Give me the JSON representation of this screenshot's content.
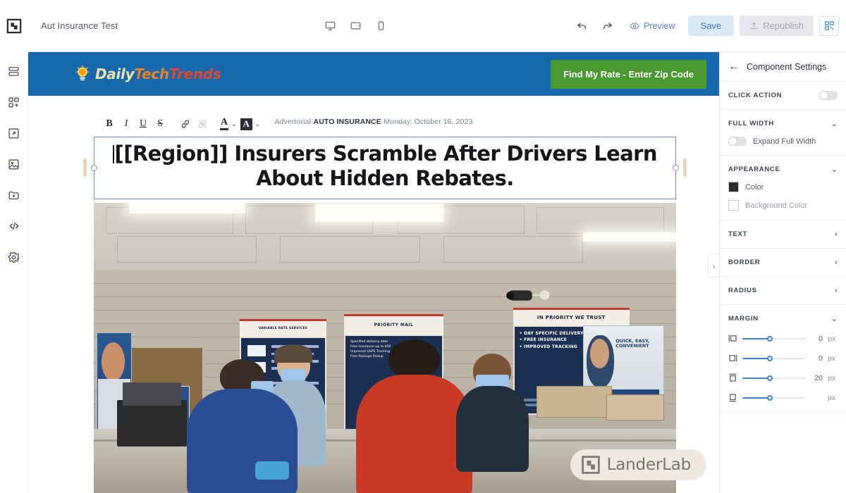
{
  "topbar": {
    "project_title": "Aut Insurance Test",
    "devices": [
      {
        "name": "desktop",
        "label": "Desktop"
      },
      {
        "name": "tablet",
        "label": "Tablet"
      },
      {
        "name": "mobile",
        "label": "Mobile"
      }
    ],
    "undo_label": "Undo",
    "redo_label": "Redo",
    "preview_label": "Preview",
    "save_label": "Save",
    "republish_label": "Republish",
    "qr_label": "QR Code"
  },
  "rail": {
    "items": [
      {
        "name": "sections",
        "label": "Sections"
      },
      {
        "name": "add-component",
        "label": "Add Component"
      },
      {
        "name": "popup",
        "label": "Popup"
      },
      {
        "name": "images",
        "label": "Images"
      },
      {
        "name": "assets",
        "label": "Assets"
      },
      {
        "name": "custom-code",
        "label": "Custom Code"
      },
      {
        "name": "settings",
        "label": "Settings"
      }
    ]
  },
  "editor_toolbar": {
    "buttons": [
      {
        "name": "bold",
        "glyph": "B",
        "label": "Bold",
        "dim": false
      },
      {
        "name": "italic",
        "glyph": "I",
        "label": "Italic",
        "dim": false
      },
      {
        "name": "underline",
        "glyph": "U",
        "label": "Underline",
        "dim": false
      },
      {
        "name": "strikethrough",
        "glyph": "S",
        "label": "Strikethrough",
        "dim": false
      },
      {
        "name": "link",
        "glyph": "⚭",
        "label": "Insert Link",
        "dim": false
      },
      {
        "name": "unlink",
        "glyph": "⚭",
        "label": "Remove Link",
        "dim": true
      }
    ],
    "text_color_label": "Text Color",
    "highlight_color_label": "Highlight Color",
    "text_color_glyph": "A",
    "highlight_glyph": "A",
    "chevron": "⌄"
  },
  "page": {
    "logo": {
      "daily": "Daily",
      "tech": "Tech",
      "trends": "Trends"
    },
    "cta_label": "Find My Rate - Enter Zip Code",
    "advertorial": {
      "prefix": "Advertorial",
      "category": "AUTO INSURANCE",
      "date": "Monday, October 16, 2023",
      "separator": "·"
    },
    "headline": "[[Region]] Insurers Scramble After Drivers Learn About Hidden Rebates.",
    "hero_signs": {
      "priority_title": "IN PRIORITY WE TRUST",
      "priority_items": [
        "DAY SPECIFIC DELIVERY",
        "FREE INSURANCE",
        "IMPROVED TRACKING"
      ],
      "variable_rate": "VARIABLE RATE SERVICES",
      "priority_mail": "PRIORITY MAIL",
      "mail_items": [
        "Specified delivery date",
        "Free insurance up to $50",
        "Improved USPS Tracking",
        "Free Package Pickup"
      ],
      "poster_text": "QUICK, EASY, CONVENIENT"
    },
    "watermark": "LanderLab"
  },
  "panel": {
    "title": "Component Settings",
    "back_label": "Back",
    "sections": [
      {
        "name": "click-action",
        "label": "CLICK ACTION",
        "type": "toggle",
        "enabled": false
      },
      {
        "name": "full-width",
        "label": "FULL WIDTH",
        "type": "expanded",
        "chevron": "⌄",
        "toggle_label": "Expand Full Width",
        "enabled": false
      },
      {
        "name": "appearance",
        "label": "APPEARANCE",
        "type": "expanded",
        "chevron": "⌄",
        "color_label": "Color",
        "color_value": "#2b2b2b",
        "bg_label": "Background Color",
        "bg_value": ""
      },
      {
        "name": "text",
        "label": "TEXT",
        "type": "collapsed",
        "chevron": "‹"
      },
      {
        "name": "border",
        "label": "BORDER",
        "type": "collapsed",
        "chevron": "‹"
      },
      {
        "name": "radius",
        "label": "RADIUS",
        "type": "collapsed",
        "chevron": "‹"
      },
      {
        "name": "margin",
        "label": "MARGIN",
        "type": "expanded",
        "chevron": "⌄"
      }
    ],
    "margin": {
      "unit": "px",
      "rows": [
        {
          "name": "margin-left",
          "icon": "margin-left-icon",
          "value": "0",
          "pct": 45
        },
        {
          "name": "margin-right",
          "icon": "margin-right-icon",
          "value": "0",
          "pct": 45
        },
        {
          "name": "margin-top",
          "icon": "margin-top-icon",
          "value": "20",
          "pct": 45
        }
      ]
    }
  },
  "colors": {
    "site_header": "#1668ad",
    "cta_green": "#4a9930",
    "save_blue": "#3f7cc4",
    "selection_blue": "#6f93c4",
    "slider_blue": "#3b82d6"
  }
}
